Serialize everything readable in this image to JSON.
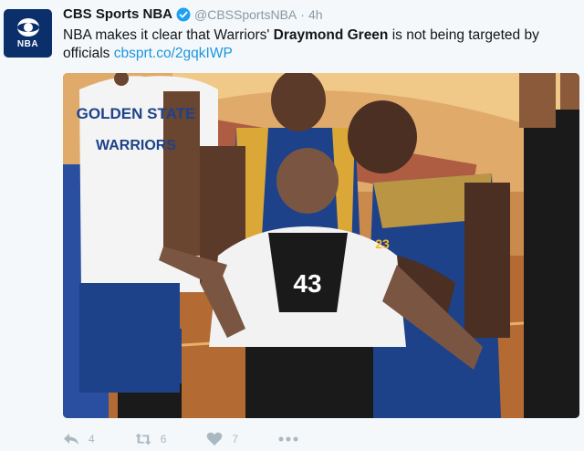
{
  "tweet": {
    "author_name": "CBS Sports NBA",
    "handle": "@CBSSportsNBA",
    "separator": "·",
    "time": "4h",
    "avatar_label": "NBA",
    "text_part1": "NBA makes it clear that Warriors' ",
    "text_bold": "Draymond Green",
    "text_part2": " is not being targeted by officials ",
    "link": "cbsprt.co/2gqkIWP"
  },
  "photo": {
    "shirt_line1": "GOLDEN STATE",
    "shirt_line2": "WARRIORS",
    "referee_number": "43",
    "player_number": "23"
  },
  "actions": {
    "reply_count": "4",
    "retweet_count": "6",
    "like_count": "7"
  },
  "colors": {
    "link": "#1b95e0",
    "warriors_blue": "#1d428a",
    "warriors_gold": "#fdb927",
    "icon_gray": "#aab8c2"
  }
}
